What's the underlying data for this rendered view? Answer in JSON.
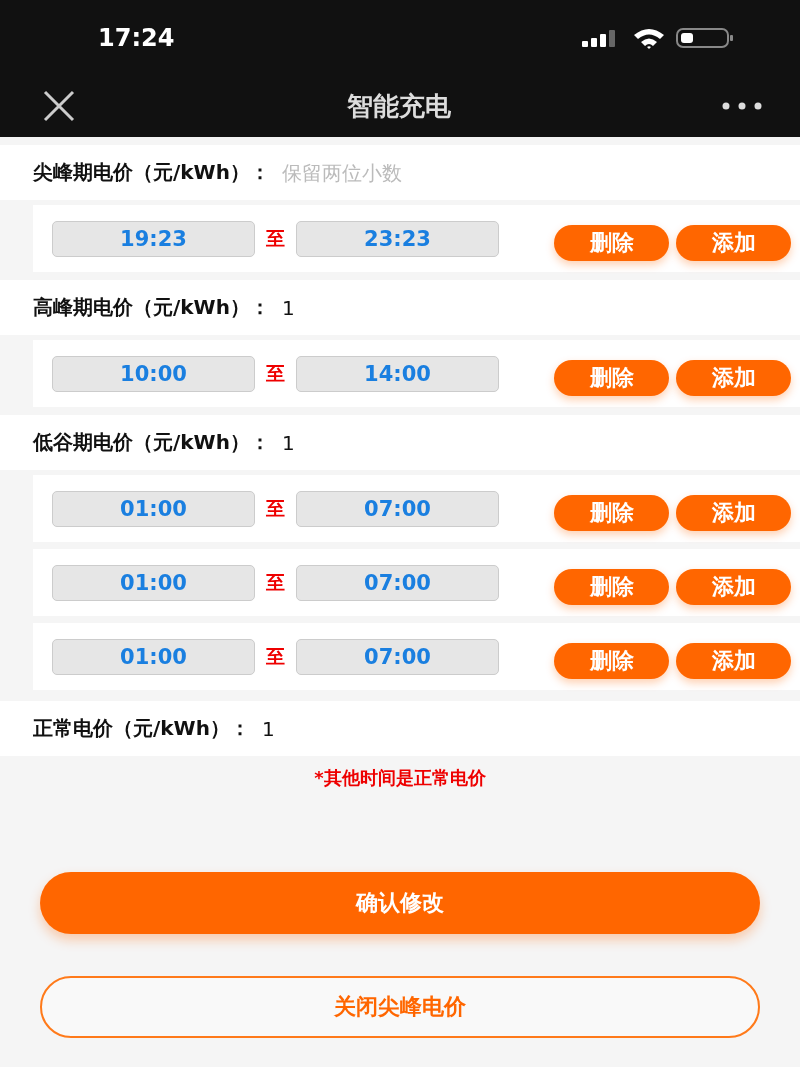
{
  "status_bar": {
    "time": "17:24"
  },
  "nav": {
    "title": "智能充电"
  },
  "sections": [
    {
      "label": "尖峰期电价（元/kWh）：",
      "placeholder": "保留两位小数",
      "ranges": [
        {
          "start": "19:23",
          "sep": "至",
          "end": "23:23",
          "delete": "删除",
          "add": "添加"
        }
      ]
    },
    {
      "label": "高峰期电价（元/kWh）：",
      "value": "1",
      "ranges": [
        {
          "start": "10:00",
          "sep": "至",
          "end": "14:00",
          "delete": "删除",
          "add": "添加"
        }
      ]
    },
    {
      "label": "低谷期电价（元/kWh）：",
      "value": "1",
      "ranges": [
        {
          "start": "01:00",
          "sep": "至",
          "end": "07:00",
          "delete": "删除",
          "add": "添加"
        },
        {
          "start": "01:00",
          "sep": "至",
          "end": "07:00",
          "delete": "删除",
          "add": "添加"
        },
        {
          "start": "01:00",
          "sep": "至",
          "end": "07:00",
          "delete": "删除",
          "add": "添加"
        }
      ]
    }
  ],
  "normal": {
    "label": "正常电价（元/kWh）：",
    "value": "1"
  },
  "note": "*其他时间是正常电价",
  "buttons": [
    {
      "label": "确认修改",
      "kind": "primary"
    },
    {
      "label": "关闭尖峰电价",
      "kind": "outline"
    }
  ]
}
